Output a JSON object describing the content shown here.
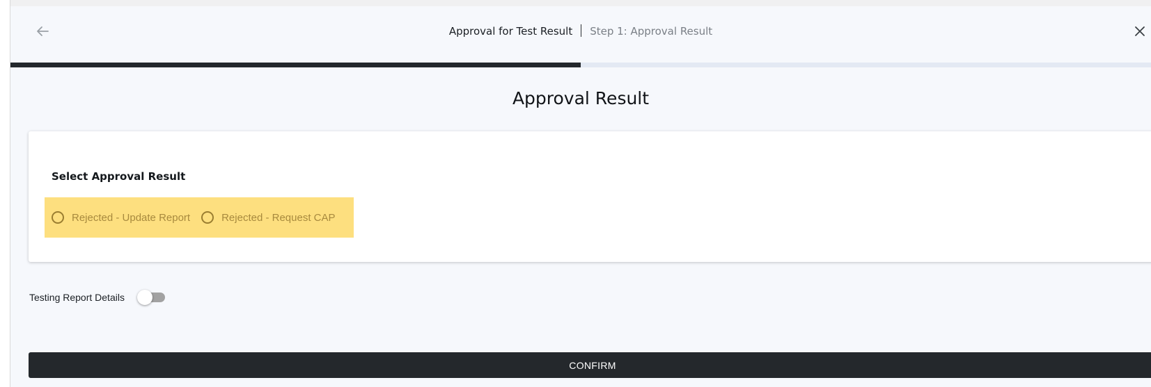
{
  "header": {
    "title": "Approval for Test Result",
    "step": "Step 1: Approval Result",
    "back_icon": "arrow-left-icon",
    "close_icon": "close-icon"
  },
  "progress": {
    "fraction": 0.5
  },
  "page_title": "Approval Result",
  "approval_card": {
    "label": "Select Approval Result",
    "options": [
      {
        "label": "Rejected - Update Report",
        "selected": false
      },
      {
        "label": "Rejected - Request CAP",
        "selected": false
      }
    ],
    "highlight_color": "#fddf7f"
  },
  "testing_report": {
    "label": "Testing Report Details",
    "enabled": false
  },
  "confirm_label": "CONFIRM",
  "colors": {
    "accent": "#24282c",
    "background": "#f6f8fc"
  }
}
